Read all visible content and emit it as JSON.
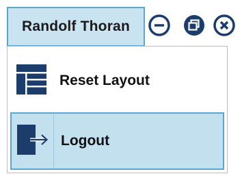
{
  "user": {
    "name": "Randolf Thoran"
  },
  "window_controls": {
    "minimize_icon": "minimize-circle-icon",
    "restore_icon": "restore-circle-icon",
    "close_icon": "close-circle-icon"
  },
  "menu": {
    "items": [
      {
        "label": "Reset Layout",
        "icon": "layout-icon"
      },
      {
        "label": "Logout",
        "icon": "logout-icon",
        "highlighted": true
      }
    ]
  },
  "colors": {
    "accent_fill": "#c3e0ee",
    "accent_border": "#5aa6cf",
    "icon_dark": "#1c3c6c"
  }
}
